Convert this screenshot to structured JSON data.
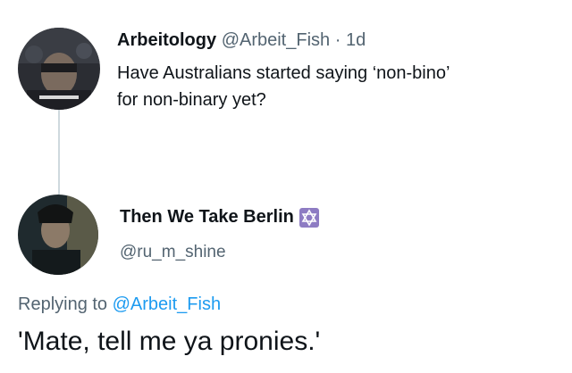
{
  "tweet": {
    "author_name": "Arbeitology",
    "author_handle": "@Arbeit_Fish",
    "separator": "·",
    "time": "1d",
    "text_line1": "Have Australians started saying ‘non-bino’",
    "text_line2": "for non-binary yet?"
  },
  "reply": {
    "author_name": "Then We Take Berlin",
    "author_handle": "@ru_m_shine",
    "badge_icon": "star-of-david-icon",
    "replying_prefix": "Replying to",
    "replying_to": "@Arbeit_Fish",
    "text": "'Mate, tell me ya pronies.'"
  },
  "colors": {
    "handle": "#536471",
    "link": "#1d9bf0",
    "thread_line": "#cfd9de",
    "badge": "#8e7cc3"
  }
}
